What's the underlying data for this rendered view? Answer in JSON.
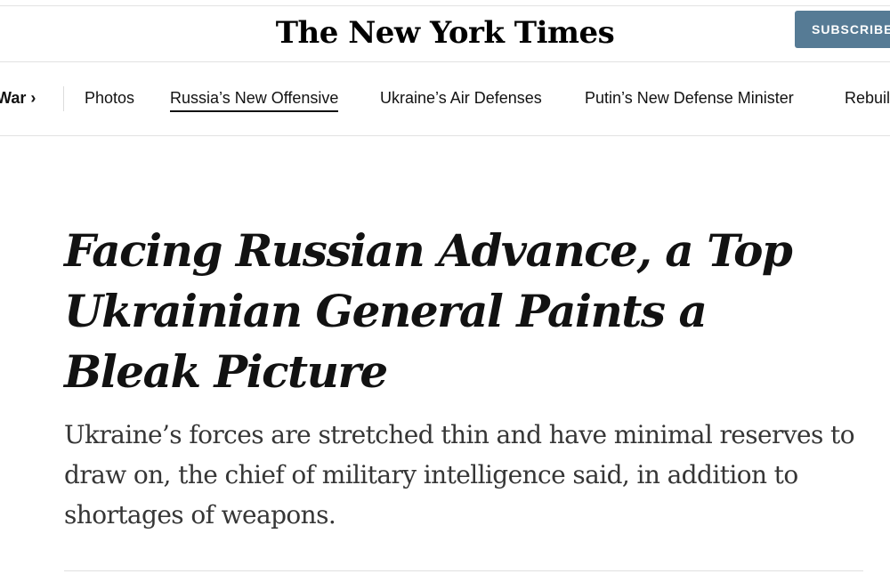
{
  "masthead": {
    "logo_text": "The New York Times",
    "subscribe_label": "SUBSCRIBE"
  },
  "nav": {
    "section_label": "War ›",
    "items": [
      {
        "label": "Photos",
        "active": false
      },
      {
        "label": "Russia’s New Offensive",
        "active": true
      },
      {
        "label": "Ukraine’s Air Defenses",
        "active": false
      },
      {
        "label": "Putin’s New Defense Minister",
        "active": false
      },
      {
        "label": "Rebuilding",
        "active": false
      }
    ]
  },
  "article": {
    "headline": "Facing Russian Advance, a Top Ukrainian General Paints a Bleak Picture",
    "summary": "Ukraine’s forces are stretched thin and have minimal reserves to draw on, the chief of military intelligence said, in addition to shortages of weapons."
  },
  "colors": {
    "subscribe_bg": "#567b95",
    "text": "#121212",
    "summary_text": "#363636",
    "rule": "#e2e2e2"
  }
}
